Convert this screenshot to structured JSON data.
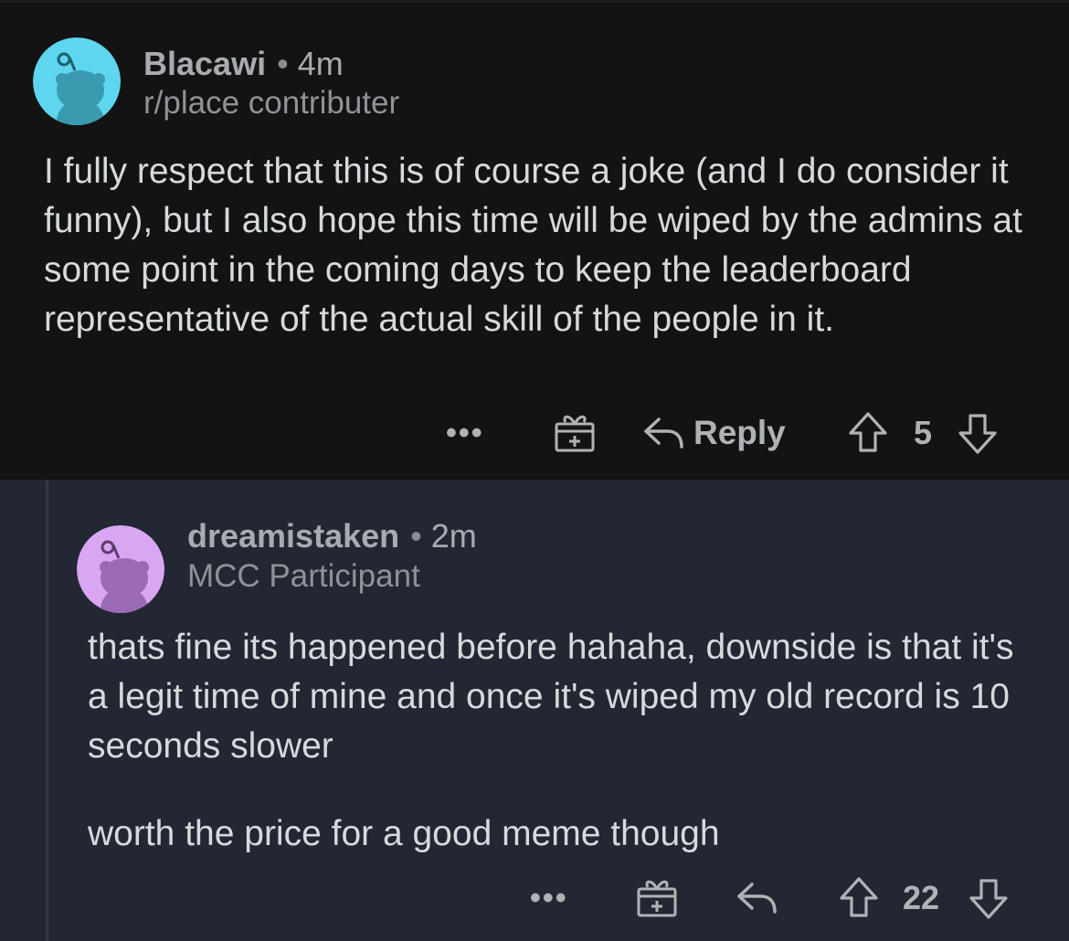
{
  "comments": [
    {
      "author": "Blacawi",
      "separator": "•",
      "age": "4m",
      "flair": "r/place contributer",
      "avatar_color": "#5ed6f0",
      "body": [
        "I fully respect that this is of course a joke (and I do consider it funny), but I also hope this time will be wiped by the admins at some point in the coming days to keep the leaderboard representative of the actual skill of the people in it."
      ],
      "actions": {
        "more": "•••",
        "award": "award-icon",
        "reply_label": "Reply",
        "score": "5"
      }
    },
    {
      "author": "dreamistaken",
      "separator": "•",
      "age": "2m",
      "flair": "MCC Participant",
      "avatar_color": "#d9a6f2",
      "body": [
        "thats fine its happened before hahaha, downside is that it's a legit time of mine and once it's wiped my old record is 10 seconds slower",
        "worth the price for a good meme though"
      ],
      "actions": {
        "more": "•••",
        "award": "award-icon",
        "reply_label": "",
        "score": "22"
      }
    }
  ],
  "colors": {
    "background": "#131313",
    "reply_background": "#222733",
    "text": "#d7dadc",
    "meta": "#a8acb0"
  }
}
